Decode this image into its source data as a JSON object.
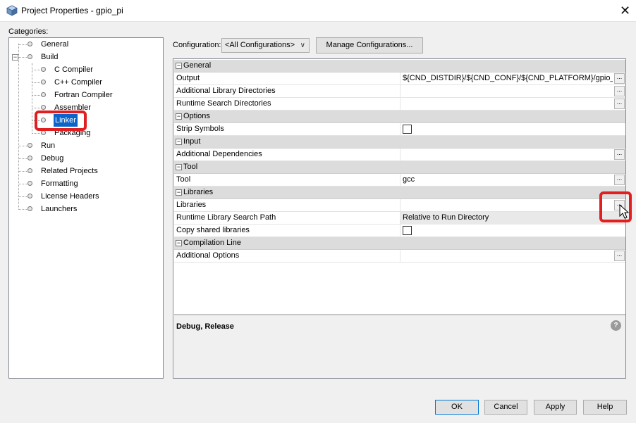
{
  "window": {
    "title": "Project Properties - gpio_pi",
    "close_icon": "close-icon",
    "app_icon": "cube-icon"
  },
  "categories": {
    "label": "Categories:",
    "items": [
      {
        "label": "General"
      },
      {
        "label": "Build"
      },
      {
        "label": "C Compiler"
      },
      {
        "label": "C++ Compiler"
      },
      {
        "label": "Fortran Compiler"
      },
      {
        "label": "Assembler"
      },
      {
        "label": "Linker"
      },
      {
        "label": "Packaging"
      },
      {
        "label": "Run"
      },
      {
        "label": "Debug"
      },
      {
        "label": "Related Projects"
      },
      {
        "label": "Formatting"
      },
      {
        "label": "License Headers"
      },
      {
        "label": "Launchers"
      }
    ],
    "selected": "Linker"
  },
  "configuration": {
    "label": "Configuration:",
    "selected": "<All Configurations>",
    "manage_button": "Manage Configurations..."
  },
  "properties": {
    "sections": {
      "general": "General",
      "options": "Options",
      "input": "Input",
      "tool": "Tool",
      "libraries": "Libraries",
      "compilation": "Compilation Line"
    },
    "rows": {
      "output": {
        "name": "Output",
        "value": "${CND_DISTDIR}/${CND_CONF}/${CND_PLATFORM}/gpio_pi"
      },
      "add_lib_dirs": {
        "name": "Additional Library Directories",
        "value": ""
      },
      "runtime_dirs": {
        "name": "Runtime Search Directories",
        "value": ""
      },
      "strip": {
        "name": "Strip Symbols",
        "checked": false
      },
      "add_deps": {
        "name": "Additional Dependencies",
        "value": ""
      },
      "tool": {
        "name": "Tool",
        "value": "gcc"
      },
      "libraries": {
        "name": "Libraries",
        "value": ""
      },
      "runtime_lib_path": {
        "name": "Runtime Library Search Path",
        "value": "Relative to Run Directory"
      },
      "copy_shared": {
        "name": "Copy shared libraries",
        "checked": false
      },
      "add_options": {
        "name": "Additional Options",
        "value": ""
      }
    },
    "ellipsis": "...",
    "description_title": "Debug, Release",
    "help_glyph": "?"
  },
  "buttons": {
    "ok": "OK",
    "cancel": "Cancel",
    "apply": "Apply",
    "help": "Help"
  },
  "colors": {
    "highlight": "#e02020",
    "selection": "#0a64c9"
  }
}
